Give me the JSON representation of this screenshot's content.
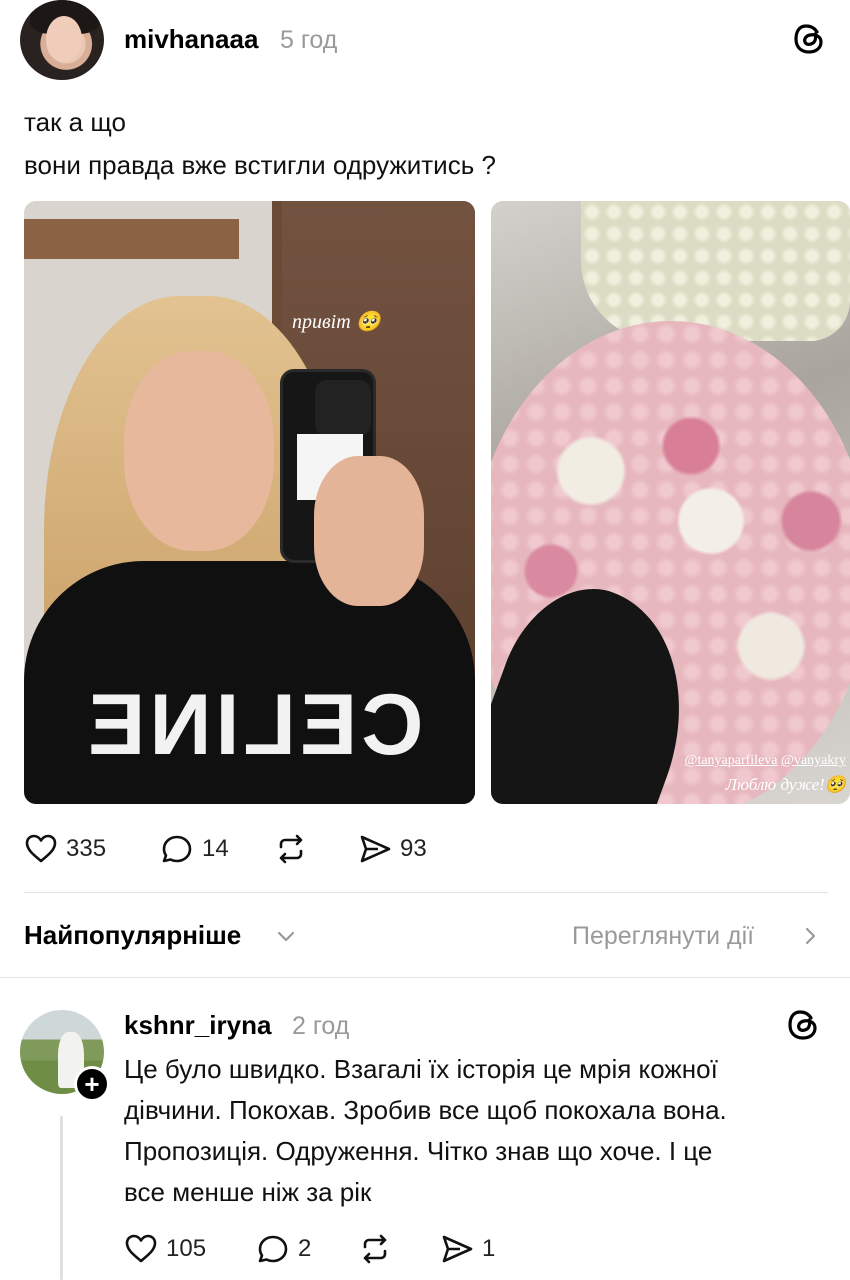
{
  "post": {
    "username": "mivhanaaa",
    "time": "5 год",
    "text_lines": [
      "так а що",
      "вони правда вже встигли одружитись ?"
    ],
    "image1": {
      "caption": "привіт 🥺"
    },
    "image2": {
      "tag1": "@tanyaparfileva",
      "tag2": "@vanyakry",
      "caption": "Люблю дуже!🥺"
    },
    "likes": "335",
    "comments": "14",
    "shares": "93"
  },
  "sort": {
    "label": "Найпопулярніше",
    "view_activity": "Переглянути дії"
  },
  "reply": {
    "username": "kshnr_iryna",
    "time": "2 год",
    "text_lines": [
      "Це було швидко. Взагалі їх історія це мрія кожної",
      "дівчини. Покохав. Зробив все щоб покохала вона.",
      "Пропозиція. Одруження. Чітко знав що хоче. І це",
      "все менше ніж за рік"
    ],
    "likes": "105",
    "comments": "2",
    "shares": "1",
    "follow_symbol": "+"
  },
  "icons": {
    "threads": "threads-logo-icon",
    "like": "heart-icon",
    "comment": "comment-bubble-icon",
    "repost": "repost-icon",
    "share": "send-icon",
    "chevron_down": "chevron-down-icon",
    "chevron_right": "chevron-right-icon"
  },
  "colors": {
    "text": "#000000",
    "secondary": "#9a9a9a",
    "divider": "#e2e2e2"
  }
}
